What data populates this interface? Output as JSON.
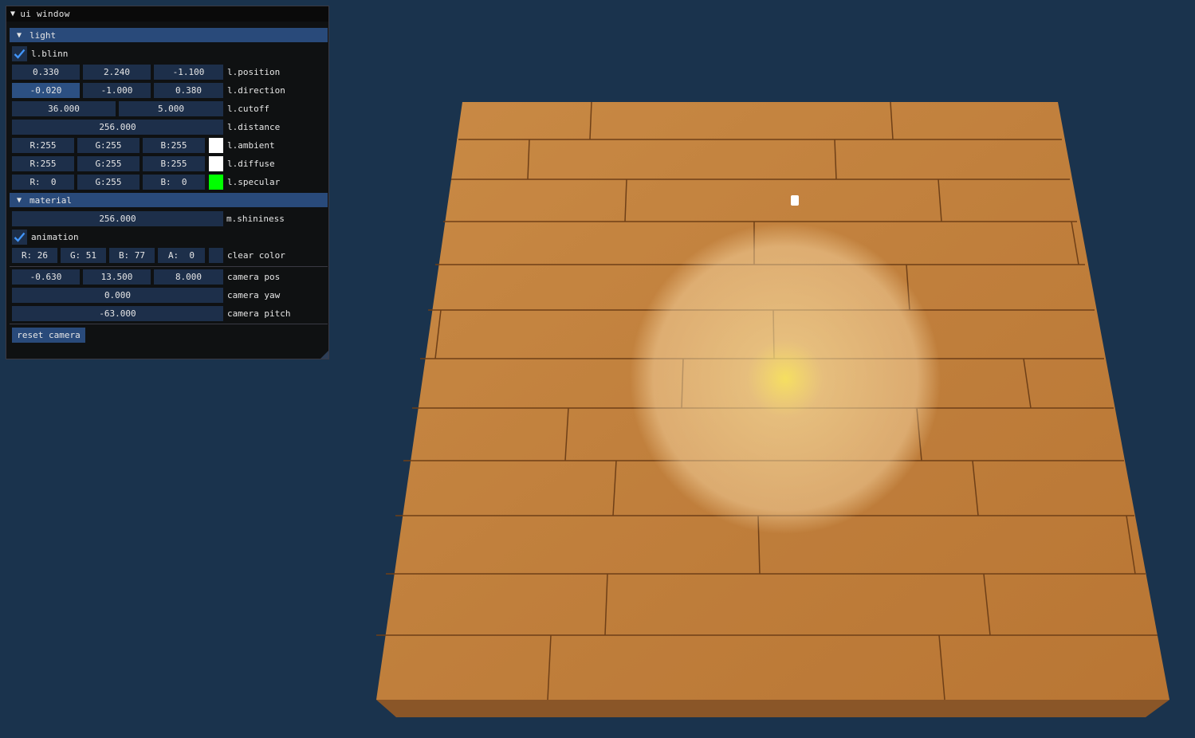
{
  "window": {
    "title": "ui window"
  },
  "light": {
    "header": "light",
    "blinn": {
      "label": "l.blinn",
      "checked": true
    },
    "position": {
      "label": "l.position",
      "values": [
        "0.330",
        "2.240",
        "-1.100"
      ]
    },
    "direction": {
      "label": "l.direction",
      "values": [
        "-0.020",
        "-1.000",
        "0.380"
      ]
    },
    "cutoff": {
      "label": "l.cutoff",
      "values": [
        "36.000",
        "5.000"
      ]
    },
    "distance": {
      "label": "l.distance",
      "value": "256.000"
    },
    "ambient": {
      "label": "l.ambient",
      "values": [
        "R:255",
        "G:255",
        "B:255"
      ],
      "color": "#ffffff"
    },
    "diffuse": {
      "label": "l.diffuse",
      "values": [
        "R:255",
        "G:255",
        "B:255"
      ],
      "color": "#ffffff"
    },
    "specular": {
      "label": "l.specular",
      "values": [
        "R:  0",
        "G:255",
        "B:  0"
      ],
      "color": "#00ff00"
    }
  },
  "material": {
    "header": "material",
    "shininess": {
      "label": "m.shininess",
      "value": "256.000"
    }
  },
  "animation": {
    "label": "animation",
    "checked": true
  },
  "clear_color": {
    "label": "clear color",
    "values": [
      "R: 26",
      "G: 51",
      "B: 77",
      "A:  0"
    ],
    "color": "#1a334d"
  },
  "camera": {
    "pos": {
      "label": "camera pos",
      "values": [
        "-0.630",
        "13.500",
        "8.000"
      ]
    },
    "yaw": {
      "label": "camera yaw",
      "value": "0.000"
    },
    "pitch": {
      "label": "camera pitch",
      "value": "-63.000"
    },
    "reset_label": "reset camera"
  },
  "colors": {
    "background": "#1a334d",
    "header": "#294a7a",
    "frame": "#1d2f4a",
    "check": "#4296fa"
  },
  "icons": {
    "collapse": "triangle-down-icon",
    "check": "checkmark-icon",
    "resize": "resize-grip-icon"
  }
}
